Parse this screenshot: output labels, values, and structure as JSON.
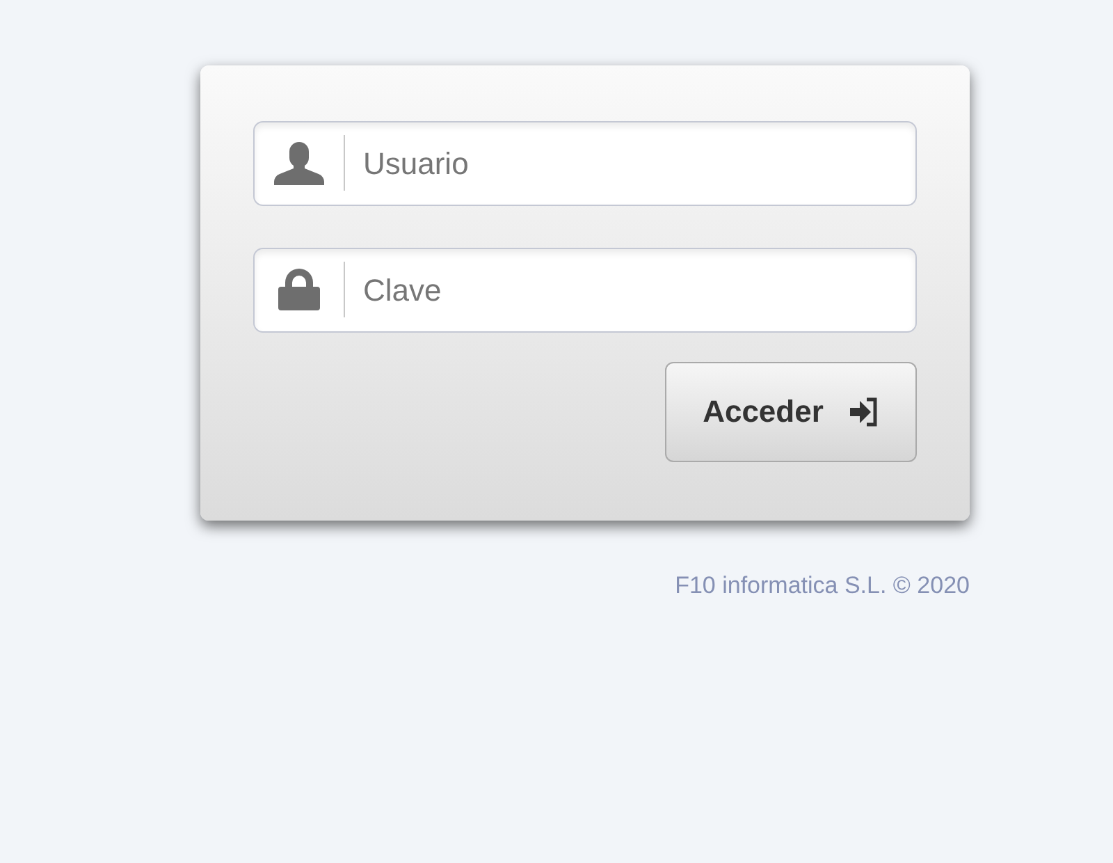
{
  "login_form": {
    "fields": [
      {
        "kind": "user",
        "placeholder": "Usuario"
      },
      {
        "kind": "password",
        "placeholder": "Clave"
      }
    ],
    "submit_button": {
      "label": "Acceder"
    }
  },
  "footer": {
    "copyright": "F10 informatica S.L. © 2020"
  }
}
